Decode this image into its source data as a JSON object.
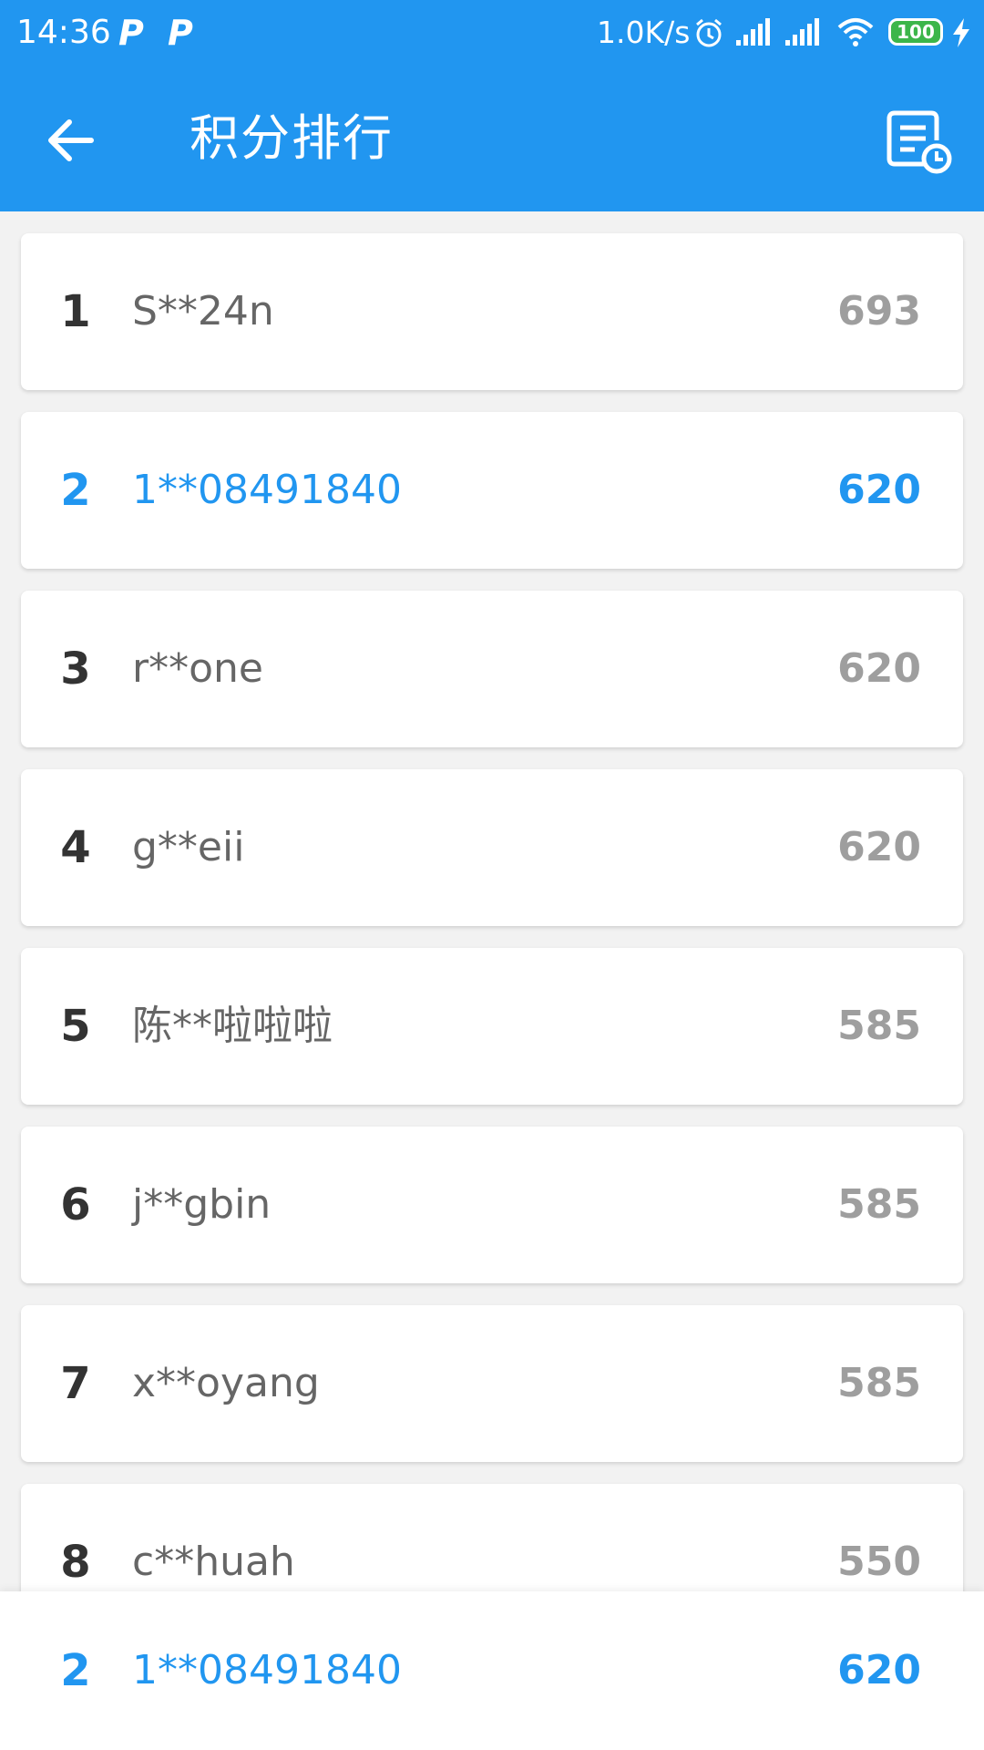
{
  "status_bar": {
    "time": "14:36",
    "notif_1": "P",
    "notif_2": "P",
    "net_speed": "1.0K/s",
    "battery": "100",
    "icons": [
      "alarm-icon",
      "signal-icon",
      "signal-icon",
      "wifi-icon",
      "battery-icon",
      "charging-icon"
    ]
  },
  "app_bar": {
    "title": "积分排行",
    "back_icon": "arrow-left-icon",
    "history_icon": "document-clock-icon"
  },
  "ranking": [
    {
      "rank": "1",
      "name": "S**24n",
      "score": "693",
      "is_me": false
    },
    {
      "rank": "2",
      "name": "1**08491840",
      "score": "620",
      "is_me": true
    },
    {
      "rank": "3",
      "name": "r**one",
      "score": "620",
      "is_me": false
    },
    {
      "rank": "4",
      "name": "g**eii",
      "score": "620",
      "is_me": false
    },
    {
      "rank": "5",
      "name": "陈**啦啦啦",
      "score": "585",
      "is_me": false
    },
    {
      "rank": "6",
      "name": "j**gbin",
      "score": "585",
      "is_me": false
    },
    {
      "rank": "7",
      "name": "x**oyang",
      "score": "585",
      "is_me": false
    },
    {
      "rank": "8",
      "name": "c**huah",
      "score": "550",
      "is_me": false
    }
  ],
  "my_rank": {
    "rank": "2",
    "name": "1**08491840",
    "score": "620"
  },
  "colors": {
    "primary": "#2196f0",
    "highlight": "#2196f0",
    "score_grey": "#9e9e9e",
    "rank_dark": "#333333"
  }
}
